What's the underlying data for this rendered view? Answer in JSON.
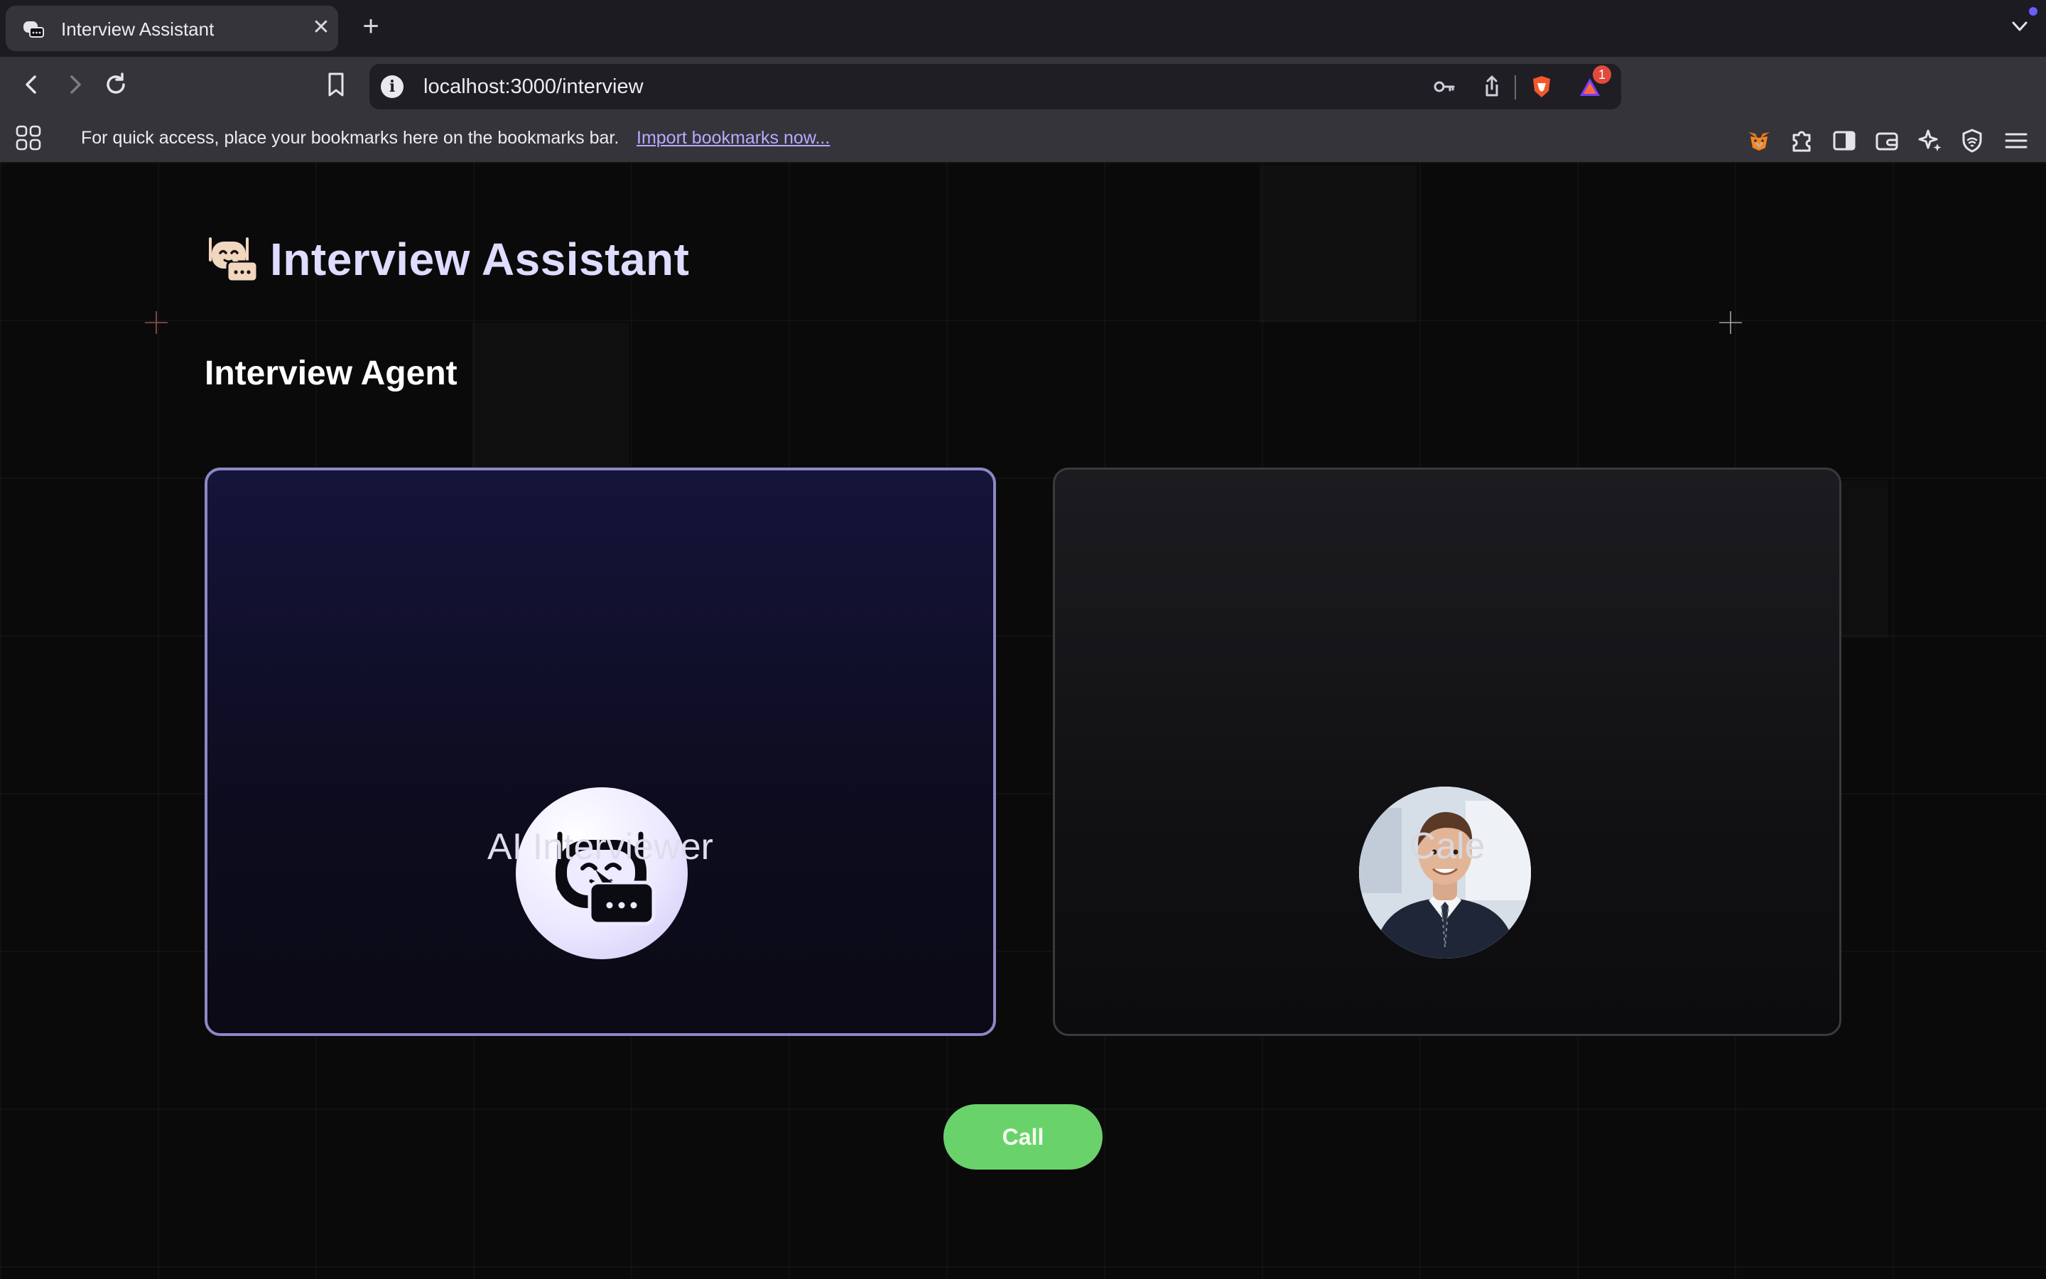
{
  "browser": {
    "tab": {
      "title": "Interview Assistant",
      "close": "✕",
      "new_tab": "+"
    },
    "url": "localhost:3000/interview",
    "url_info": "i",
    "badge_count": "1",
    "bookmarks_bar": {
      "message": "For quick access, place your bookmarks here on the bookmarks bar.",
      "link": "Import bookmarks now..."
    },
    "icons": [
      "back-icon",
      "forward-icon",
      "reload-icon",
      "bookmark-icon",
      "info-icon",
      "key-icon",
      "share-icon",
      "brave-shield-icon",
      "brave-rewards-icon",
      "metamask-fox-icon",
      "puzzle-extensions-icon",
      "sidebar-icon",
      "wallet-icon",
      "leo-ai-icon",
      "vpn-shield-icon",
      "menu-icon"
    ]
  },
  "header": {
    "title": "Interview Assistant"
  },
  "section": {
    "title": "Interview Agent"
  },
  "cards": {
    "ai": {
      "label": "AI Interviewer"
    },
    "user": {
      "label": "Cale"
    }
  },
  "actions": {
    "call_label": "Call"
  },
  "colors": {
    "accent": "#6ad26a",
    "card_ai_border": "#8d88c4",
    "title_color": "#dedcff",
    "link_color": "#b9a9ff"
  }
}
